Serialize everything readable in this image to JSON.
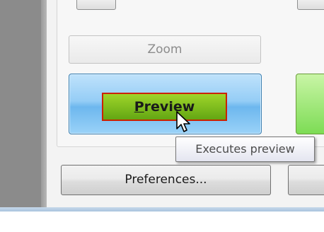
{
  "buttons": {
    "zoom_label": "Zoom",
    "preview_label_first": "P",
    "preview_label_rest": "review",
    "preferences_label": "Preferences..."
  },
  "tooltip": {
    "text": "Executes preview"
  },
  "colors": {
    "preview_fill": "#7fc21c",
    "preview_border": "#cc2200",
    "selected_button_blue": "#95cdf6",
    "green_button": "#7ddc55"
  },
  "icons": {
    "cursor": "arrow-cursor-icon"
  }
}
